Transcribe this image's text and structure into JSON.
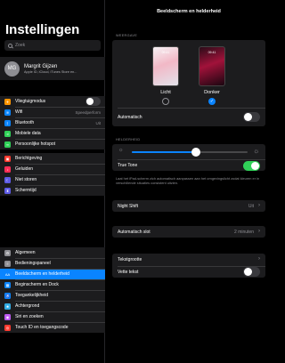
{
  "sidebar": {
    "title": "Instellingen",
    "search_placeholder": "Zoek",
    "profile": {
      "initials": "MG",
      "name": "Margrit Gijzen",
      "subtitle": "Apple ID, iCloud, iTunes Store en..."
    },
    "group1": [
      {
        "label": "Vliegtuigmodus",
        "icon": "airplane-icon",
        "color": "#ff9500",
        "glyph": "✈",
        "toggle": true
      },
      {
        "label": "Wifi",
        "icon": "wifi-icon",
        "color": "#0a84ff",
        "glyph": "≋",
        "value": "Speedperform"
      },
      {
        "label": "Bluetooth",
        "icon": "bluetooth-icon",
        "color": "#0a84ff",
        "glyph": "ᛒ",
        "value": "Uit"
      },
      {
        "label": "Mobiele data",
        "icon": "cellular-icon",
        "color": "#30d158",
        "glyph": "ıl"
      },
      {
        "label": "Persoonlijke hotspot",
        "icon": "hotspot-icon",
        "color": "#30d158",
        "glyph": "∞"
      }
    ],
    "group2": [
      {
        "label": "Berichtgeving",
        "icon": "notifications-icon",
        "color": "#ff3b30",
        "glyph": "▣"
      },
      {
        "label": "Geluiden",
        "icon": "sounds-icon",
        "color": "#ff2d55",
        "glyph": "♪"
      },
      {
        "label": "Niet storen",
        "icon": "moon-icon",
        "color": "#5e5ce6",
        "glyph": "☾"
      },
      {
        "label": "Schermtijd",
        "icon": "hourglass-icon",
        "color": "#5e5ce6",
        "glyph": "⧗"
      }
    ],
    "group3": [
      {
        "label": "Algemeen",
        "icon": "gear-icon",
        "color": "#8e8e93",
        "glyph": "⚙"
      },
      {
        "label": "Bedieningspaneel",
        "icon": "control-center-icon",
        "color": "#8e8e93",
        "glyph": "≡"
      },
      {
        "label": "Beeldscherm en helderheid",
        "icon": "display-icon",
        "color": "#0a84ff",
        "glyph": "AA",
        "selected": true
      },
      {
        "label": "Beginscherm en Dock",
        "icon": "home-screen-icon",
        "color": "#0a84ff",
        "glyph": "▦"
      },
      {
        "label": "Toegankelijkheid",
        "icon": "accessibility-icon",
        "color": "#0a84ff",
        "glyph": "♿"
      },
      {
        "label": "Achtergrond",
        "icon": "wallpaper-icon",
        "color": "#32ade6",
        "glyph": "❀"
      },
      {
        "label": "Siri en zoeken",
        "icon": "siri-icon",
        "color": "#bf5af2",
        "glyph": "◉"
      },
      {
        "label": "Touch ID en toegangscode",
        "icon": "fingerprint-icon",
        "color": "#ff3b30",
        "glyph": "◎"
      }
    ]
  },
  "main": {
    "title": "Beeldscherm en helderheid",
    "appearance_header": "WEERGAVE",
    "light_label": "Licht",
    "dark_label": "Donker",
    "preview_time": "09:41",
    "selected_mode": "Donker",
    "automatic_label": "Automatisch",
    "brightness_header": "HELDERHEID",
    "brightness_level": 0.55,
    "true_tone_label": "True Tone",
    "true_tone_note": "Laat het iPad-scherm zich automatisch aanpassen aan het omgevingslicht zodat kleuren er in verschillende situaties consistent uitzien.",
    "night_shift_label": "Night Shift",
    "night_shift_value": "Uit",
    "auto_lock_label": "Automatisch slot",
    "auto_lock_value": "2 minuten",
    "text_size_label": "Tekstgrootte",
    "bold_text_label": "Vette tekst"
  }
}
